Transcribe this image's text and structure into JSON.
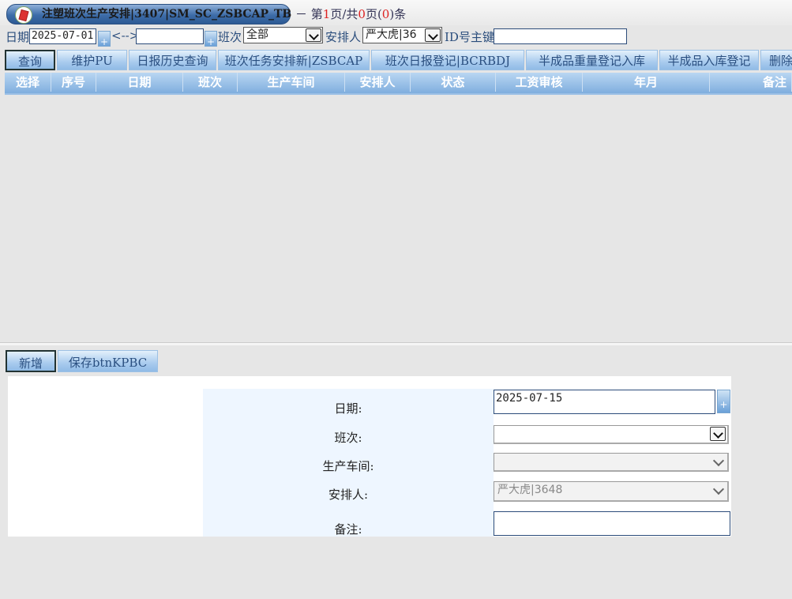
{
  "window": {
    "title": "注塑班次生产安排|3407|SM_SC_ZSBCAP_TB",
    "pager": {
      "prefix": "－ 第",
      "page": "1",
      "mid": "页/共",
      "total_pages": "0",
      "mid2": "页(",
      "count": "0",
      "suffix": ")条"
    }
  },
  "filters": {
    "date_label": "日期",
    "date_from": "2025-07-01",
    "plus": "+",
    "range_sep": "<-->",
    "date_to": "",
    "shift_label": "班次",
    "shift_value": "全部",
    "arranger_label": "安排人",
    "arranger_value": "严大虎|36",
    "id_label": "ID号主键",
    "id_value": ""
  },
  "toolbar": [
    {
      "label": "查询"
    },
    {
      "label": "维护PU"
    },
    {
      "label": "日报历史查询"
    },
    {
      "label": "班次任务安排新|ZSBCAP"
    },
    {
      "label": "班次日报登记|BCRBDJ"
    },
    {
      "label": "半成品重量登记入库"
    },
    {
      "label": "半成品入库登记"
    },
    {
      "label": "删除"
    }
  ],
  "grid": {
    "columns": [
      "选择",
      "序号",
      "日期",
      "班次",
      "生产车间",
      "安排人",
      "状态",
      "工资审核",
      "年月",
      "备注"
    ],
    "rows": []
  },
  "bottom_buttons": [
    {
      "label": "新增"
    },
    {
      "label": "保存btnKPBC"
    }
  ],
  "form": {
    "date_label": "日期:",
    "date_value": "2025-07-15",
    "date_plus": "+",
    "shift_label": "班次:",
    "shift_value": "",
    "workshop_label": "生产车间:",
    "workshop_value": "",
    "arranger_label": "安排人:",
    "arranger_value": "严大虎|3648",
    "remark_label": "备注:",
    "remark_value": ""
  }
}
